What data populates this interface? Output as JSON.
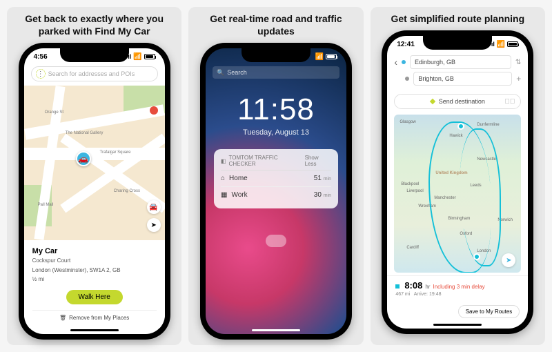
{
  "panel1": {
    "title": "Get back to exactly where you parked with Find My Car",
    "time": "4:56",
    "search_placeholder": "Search for addresses and POIs",
    "map_labels": {
      "gallery": "The National Gallery",
      "street1": "Orange St",
      "street2": "Trafalgar Square",
      "street3": "Charing Cross",
      "street4": "Pall Mall"
    },
    "card": {
      "title": "My Car",
      "address1": "Cockspur Court",
      "address2": "London (Westminster), SW1A 2, GB",
      "distance": "½ mi",
      "walk_label": "Walk Here",
      "remove_label": "Remove from My Places"
    }
  },
  "panel2": {
    "title": "Get real-time road and traffic updates",
    "search_label": "Search",
    "clock": "11:58",
    "date": "Tuesday, August 13",
    "widget": {
      "header": "TOMTOM TRAFFIC CHECKER",
      "show_less": "Show Less",
      "rows": [
        {
          "icon": "home-icon",
          "label": "Home",
          "value": "51",
          "unit": "min"
        },
        {
          "icon": "work-icon",
          "label": "Work",
          "value": "30",
          "unit": "min"
        }
      ]
    }
  },
  "panel3": {
    "title": "Get simplified route planning",
    "time": "12:41",
    "origin": "Edinburgh, GB",
    "destination": "Brighton, GB",
    "send_destination": "Send destination",
    "cities": {
      "glasgow": "Glasgow",
      "newcastle": "Newcastle",
      "hawick": "Hawick",
      "leeds": "Leeds",
      "manchester": "Manchester",
      "liverpool": "Liverpool",
      "birmingham": "Birmingham",
      "norwich": "Norwich",
      "cardiff": "Cardiff",
      "london": "London",
      "oxford": "Oxford",
      "dunfermline": "Dunfermline",
      "blackpool": "Blackpool",
      "wrexham": "Wrexham",
      "united_kingdom": "United Kingdom"
    },
    "summary": {
      "time": "8:08",
      "time_unit": "hr",
      "delay_prefix": "Including",
      "delay": "3 min delay",
      "distance": "467 mi",
      "arrive_label": "Arrive:",
      "arrive_time": "19:48"
    },
    "save_label": "Save to My Routes"
  }
}
